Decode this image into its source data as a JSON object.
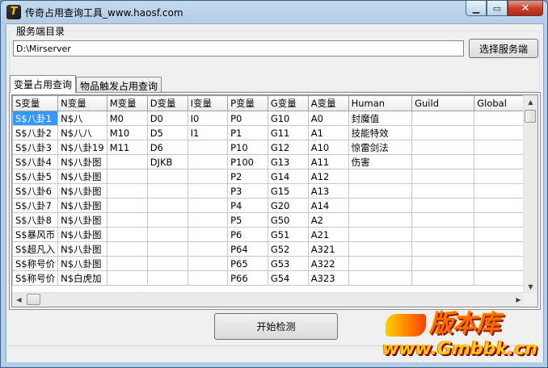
{
  "window": {
    "title": "传奇占用查询工具_www.haosf.com",
    "icon_glyph": "T",
    "minimize": "▁",
    "maximize": "▭",
    "close": "✕"
  },
  "server_dir": {
    "label": "服务端目录",
    "path": "D:\\Mirserver",
    "select_button": "选择服务端"
  },
  "tabs": [
    {
      "label": "变量占用查询",
      "active": true
    },
    {
      "label": "物品触发占用查询",
      "active": false
    }
  ],
  "grid": {
    "headers": [
      "S变量",
      "N变量",
      "M变量",
      "D变量",
      "I变量",
      "P变量",
      "G变量",
      "A变量",
      "Human",
      "Guild",
      "Global"
    ],
    "rows": [
      [
        "S$八卦1",
        "N$八",
        "M0",
        "D0",
        "I0",
        "P0",
        "G10",
        "A0",
        "封魔值",
        "",
        ""
      ],
      [
        "S$八卦2",
        "N$八八",
        "M10",
        "D5",
        "I1",
        "P1",
        "G11",
        "A1",
        "技能特效",
        "",
        ""
      ],
      [
        "S$八卦3",
        "N$八卦19",
        "M11",
        "D6",
        "",
        "P10",
        "G12",
        "A10",
        "惊雷剑法",
        "",
        ""
      ],
      [
        "S$八卦4",
        "N$八卦图",
        "",
        "DJKB",
        "",
        "P100",
        "G13",
        "A11",
        "伤害",
        "",
        ""
      ],
      [
        "S$八卦5",
        "N$八卦图",
        "",
        "",
        "",
        "P2",
        "G14",
        "A12",
        "",
        "",
        ""
      ],
      [
        "S$八卦6",
        "N$八卦图",
        "",
        "",
        "",
        "P3",
        "G15",
        "A13",
        "",
        "",
        ""
      ],
      [
        "S$八卦7",
        "N$八卦图",
        "",
        "",
        "",
        "P4",
        "G20",
        "A14",
        "",
        "",
        ""
      ],
      [
        "S$八卦8",
        "N$八卦图",
        "",
        "",
        "",
        "P5",
        "G50",
        "A2",
        "",
        "",
        ""
      ],
      [
        "S$暴风币",
        "N$八卦图",
        "",
        "",
        "",
        "P6",
        "G51",
        "A21",
        "",
        "",
        ""
      ],
      [
        "S$超凡入",
        "N$八卦图",
        "",
        "",
        "",
        "P64",
        "G52",
        "A321",
        "",
        "",
        ""
      ],
      [
        "S$称号价",
        "N$八卦图",
        "",
        "",
        "",
        "P65",
        "G53",
        "A322",
        "",
        "",
        ""
      ],
      [
        "S$称号价",
        "N$白虎加",
        "",
        "",
        "",
        "P66",
        "G54",
        "A323",
        "",
        "",
        ""
      ]
    ],
    "selected_cell": [
      0,
      0
    ]
  },
  "scrollbar": {
    "up": "▲",
    "down": "▼",
    "left": "◀",
    "right": "▶"
  },
  "start_button": "开始检测",
  "watermark": {
    "logo": "版本库",
    "url": "www.Gmbbk.cn"
  }
}
